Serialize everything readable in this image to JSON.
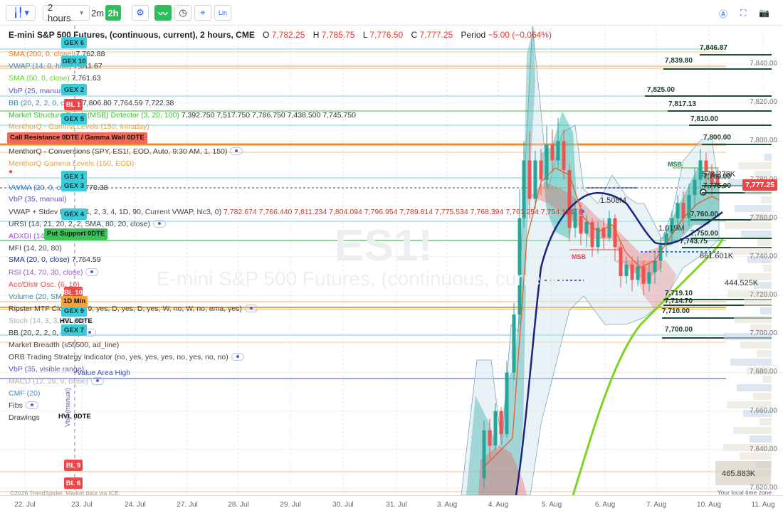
{
  "toolbar": {
    "chart_type_icon": "candles-icon",
    "interval": "2 hours",
    "quick_1": "2m",
    "quick_2": "2h",
    "lin_label": "Lin"
  },
  "header": {
    "title": "E-mini S&P 500 Futures, (continuous, current), 2 hours, CME",
    "o_label": "O",
    "o": "7,782.25",
    "h_label": "H",
    "h": "7,785.75",
    "l_label": "L",
    "l": "7,776.50",
    "c_label": "C",
    "c": "7,777.25",
    "period_label": "Period",
    "period": "−5.00 (−0.064%)"
  },
  "indicators": [
    {
      "text": "SMA (200, 0, close)",
      "value": "7,762.88",
      "color": "#e07a2f"
    },
    {
      "text": "VWAP (14, 0, hlc3)",
      "value": "7,811.67",
      "color": "#3a8fd6"
    },
    {
      "text": "SMA (50, 0, close)",
      "value": "7,761.63",
      "color": "#66d12e"
    },
    {
      "text": "VbP (25, manual)",
      "value": "",
      "color": "#6a4fb3"
    },
    {
      "text": "BB (20, 2, 2, 0, close)",
      "value": "7,806.80  7,764.59  7,722.38",
      "color": "#2c8fb8"
    },
    {
      "text": "Market Structure Break (MSB) Detector (3, 20, 100)",
      "value": "7,392.750  7,517.750  7,786.750  7,438.500  7,745.750",
      "color": "#3bbf2e"
    },
    {
      "text": "MenthorQ - Gamma Levels (150, Intraday)",
      "value": "",
      "color": "#e8a23c"
    },
    {
      "text": "MenthorQ - Conversions (SPY, ES1!, EOD, Auto, 9:30 AM, 1, 150)",
      "value": "",
      "color": "#444"
    },
    {
      "text": "MenthorQ Gamma Levels (150, EOD)",
      "value": "",
      "color": "#e8a23c"
    },
    {
      "text": "VWMA (20, 0, close)",
      "value": "7,770.38",
      "color": "#3a78c2"
    },
    {
      "text": "VbP (35, manual)",
      "value": "",
      "color": "#6a4fb3"
    },
    {
      "text": "VWAP + Stdev Bands (1, 2, 3, 4, 1D, 90, Current VWAP, hlc3, 0)",
      "value": "7,782.674  7,766.440  7,811.234  7,804.094  7,796.954  7,789.814  7,775.534  7,768.394  7,761.254  7,754.114",
      "color": "#444"
    },
    {
      "text": "URSI (14, 21, 20, 2, 2, SMA, 80, 20, close)",
      "value": "",
      "color": "#444"
    },
    {
      "text": "ADXDI (14, 14)",
      "value": "",
      "color": "#a44fd6"
    },
    {
      "text": "MFI (14, 20, 80)",
      "value": "",
      "color": "#444"
    },
    {
      "text": "SMA (20, 0, close)",
      "value": "7,764.59",
      "color": "#1c2f7a"
    },
    {
      "text": "RSI (14, 70, 30, close)",
      "value": "",
      "color": "#a44fd6"
    },
    {
      "text": "Acc/Distr Osc. (6, 10)",
      "value": "",
      "color": "#e04b4b"
    },
    {
      "text": "Volume (20, SMA)",
      "value": "",
      "color": "#2c8fb8"
    },
    {
      "text": "Ripster MTF Clouds (8, 9, yes, D, yes, D, yes, W, no, W, no, ema, yes)",
      "value": "",
      "color": "#444"
    },
    {
      "text": "Stoch (14, 3, 3, 80, 20)",
      "value": "",
      "color": "#b0b0b0"
    },
    {
      "text": "BB (20, 2, 2, 0, close)",
      "value": "",
      "color": "#444"
    },
    {
      "text": "Market Breadth (s5fi500, ad_line)",
      "value": "",
      "color": "#444"
    },
    {
      "text": "ORB Trading Strategy Indicator (no, yes, yes, yes, no, yes, no, no)",
      "value": "",
      "color": "#444"
    },
    {
      "text": "VbP (35, visible range)",
      "value": "",
      "color": "#6a4fb3"
    },
    {
      "text": "MACD (12, 26, 9, close)",
      "value": "",
      "color": "#b0b0b0"
    },
    {
      "text": "CMF (20)",
      "value": "",
      "color": "#3a8fd6"
    },
    {
      "text": "Fibs",
      "value": "",
      "color": "#444"
    },
    {
      "text": "Drawings",
      "value": "",
      "color": "#444"
    }
  ],
  "gex_tags": [
    {
      "label": "GEX 6"
    },
    {
      "label": "GEX 10"
    },
    {
      "label": "GEX 2"
    },
    {
      "label": "GEX 5"
    },
    {
      "label": "GEX 1"
    },
    {
      "label": "GEX 3"
    },
    {
      "label": "GEX 4"
    },
    {
      "label": "GEX 9"
    },
    {
      "label": "GEX 7"
    }
  ],
  "bl_tags": [
    {
      "label": "BL 1"
    },
    {
      "label": "BL 10"
    },
    {
      "label": "BL 9"
    },
    {
      "label": "BL 6"
    }
  ],
  "zone_tags": {
    "call_resistance": "Call Resistance 0DTE / Gamma Wall 0DTE",
    "put_support": "Put Support 0DTE",
    "hvl": "HVL 0DTE",
    "hvl2": "HVL 0DTE",
    "one_d_min": "1D Min",
    "value_area_high": "Value Area High",
    "manual": "VbP (manual)"
  },
  "price_axis": [
    "7,840.00",
    "7,820.00",
    "7,800.00",
    "7,780.00",
    "7,760.00",
    "7,740.00",
    "7,720.00",
    "7,700.00",
    "7,680.00",
    "7,660.00",
    "7,640.00",
    "7,620.00"
  ],
  "current_price": "7,777.25",
  "level_labels": [
    "7,846.87",
    "7,839.80",
    "7,825.00",
    "7,817.13",
    "7,810.00",
    "7,800.00",
    "7,780.00",
    "7,775.00",
    "7,760.00",
    "7,750.00",
    "7,743.75",
    "7,719.10",
    "7,714.70",
    "7,710.00",
    "7,700.00"
  ],
  "volume_labels": [
    "573.278K",
    "661.601K",
    "444.525K",
    "465.883K",
    "1.508M",
    "1.019M"
  ],
  "annotations": {
    "msb1": "MSB",
    "msb2": "MSB",
    "watermark_symbol": "ES1!",
    "watermark_name": "E-mini S&P 500 Futures, (continuous, current)"
  },
  "x_axis": [
    "22. Jul",
    "23. Jul",
    "24. Jul",
    "27. Jul",
    "28. Jul",
    "29. Jul",
    "30. Jul",
    "31. Jul",
    "3. Aug",
    "4. Aug",
    "5. Aug",
    "6. Aug",
    "7. Aug",
    "10. Aug",
    "11. Aug"
  ],
  "footer": {
    "credit": "©2026 TrendSpider. Market data via ICE.",
    "timezone": "Your local time zone"
  },
  "colors": {
    "up": "#26a69a",
    "down": "#ef5350",
    "accent": "#2962ff",
    "sma50": "#7ed321",
    "sma20": "#1a237e"
  }
}
